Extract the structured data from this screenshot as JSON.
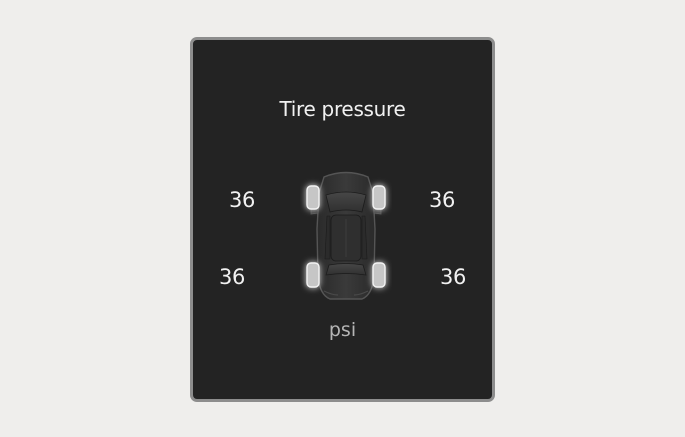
{
  "screen": {
    "title": "Tire pressure",
    "unit": "psi"
  },
  "tires": {
    "front_left": "36",
    "front_right": "36",
    "rear_left": "36",
    "rear_right": "36"
  },
  "colors": {
    "page_background": "#efeeec",
    "panel_background": "#232323",
    "panel_border": "#8d8d8d",
    "text": "#f1f1f1",
    "unit_text": "#b5b5b5",
    "tire_glow": "#ffffff"
  },
  "icons": {
    "vehicle": "car-top-view-icon"
  }
}
